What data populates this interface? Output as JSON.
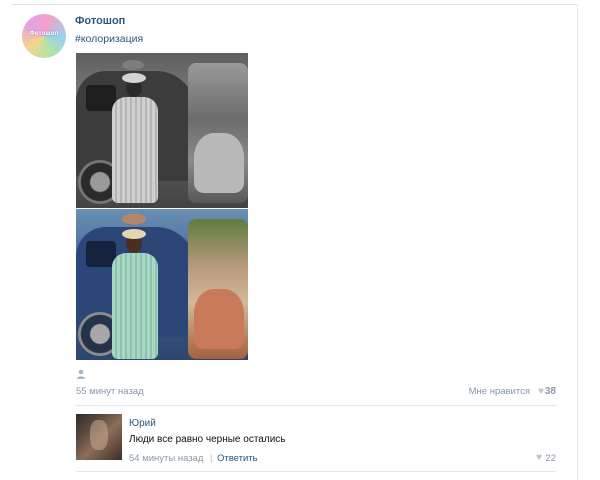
{
  "colors": {
    "link": "#2b587a",
    "meta": "#8a98a8",
    "divider": "#e4e8ec"
  },
  "post": {
    "author": "Фотошоп",
    "avatar_label": "Фотошоп",
    "hashtag": "#колоризация",
    "time": "55 минут назад",
    "like_label": "Мне нравится",
    "like_count": "38"
  },
  "comment": {
    "author": "Юрий",
    "text": "Люди все равно черные остались",
    "time": "54 минуты назад",
    "separator": "|",
    "reply_label": "Ответить",
    "like_count": "22"
  },
  "icons": {
    "like": "heart-icon",
    "author_placeholder": "person-icon"
  }
}
